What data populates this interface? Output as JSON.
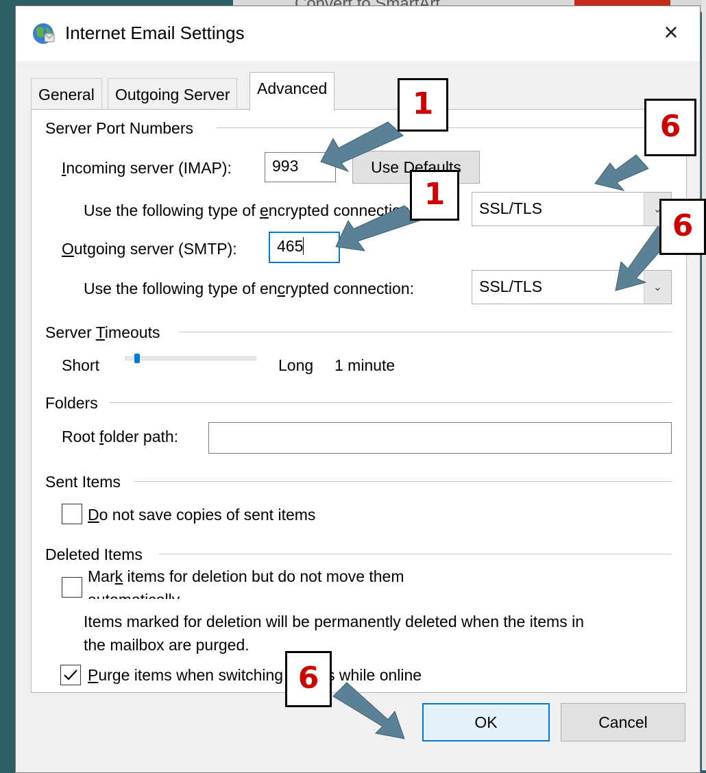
{
  "window": {
    "title": "Internet Email Settings",
    "close_glyph": "×"
  },
  "background": {
    "partial_text": "Convert to SmartArt"
  },
  "tabs": [
    {
      "label": "General",
      "active": false
    },
    {
      "label": "Outgoing Server",
      "active": false
    },
    {
      "label": "Advanced",
      "active": true
    }
  ],
  "server_ports": {
    "group_label": "Server Port Numbers",
    "incoming_pre": "",
    "incoming_u": "I",
    "incoming_post": "ncoming server (IMAP):",
    "incoming_value": "993",
    "use_defaults": "Use Defaults",
    "incoming_enc_pre": "Use the following type of ",
    "incoming_enc_u": "e",
    "incoming_enc_post": "ncrypted connection:",
    "incoming_enc_value": "SSL/TLS",
    "outgoing_u": "O",
    "outgoing_post": "utgoing server (SMTP):",
    "outgoing_value": "465",
    "outgoing_enc_pre": "Use the following type of en",
    "outgoing_enc_u": "c",
    "outgoing_enc_post": "rypted connection:",
    "outgoing_enc_value": "SSL/TLS"
  },
  "timeouts": {
    "group_pre": "Server ",
    "group_u": "T",
    "group_post": "imeouts",
    "short": "Short",
    "long": "Long",
    "value": "1 minute",
    "level_fraction": 0.08
  },
  "folders": {
    "group_label": "Folders",
    "root_pre": "Root ",
    "root_u": "f",
    "root_post": "older path:",
    "root_value": ""
  },
  "sent_items": {
    "group_label": "Sent Items",
    "checkbox_u": "D",
    "checkbox_post": "o not save copies of sent items",
    "checked": false
  },
  "deleted_items": {
    "group_label": "Deleted Items",
    "mark_pre": "Mar",
    "mark_u": "k",
    "mark_post": " items for deletion but do not move them",
    "mark_line2": "automatically",
    "mark_checked": false,
    "note_line1": "Items marked for deletion will be permanently deleted when the items in",
    "note_line2": "the mailbox are purged.",
    "purge_u": "P",
    "purge_post": "urge items when switching folders while online",
    "purge_checked": true
  },
  "buttons": {
    "ok": "OK",
    "cancel": "Cancel"
  },
  "callouts": [
    "1",
    "1",
    "6",
    "6",
    "6"
  ],
  "colors": {
    "accent": "#0078d7",
    "callout_text": "#cc0000",
    "arrow": "#5b8197"
  }
}
